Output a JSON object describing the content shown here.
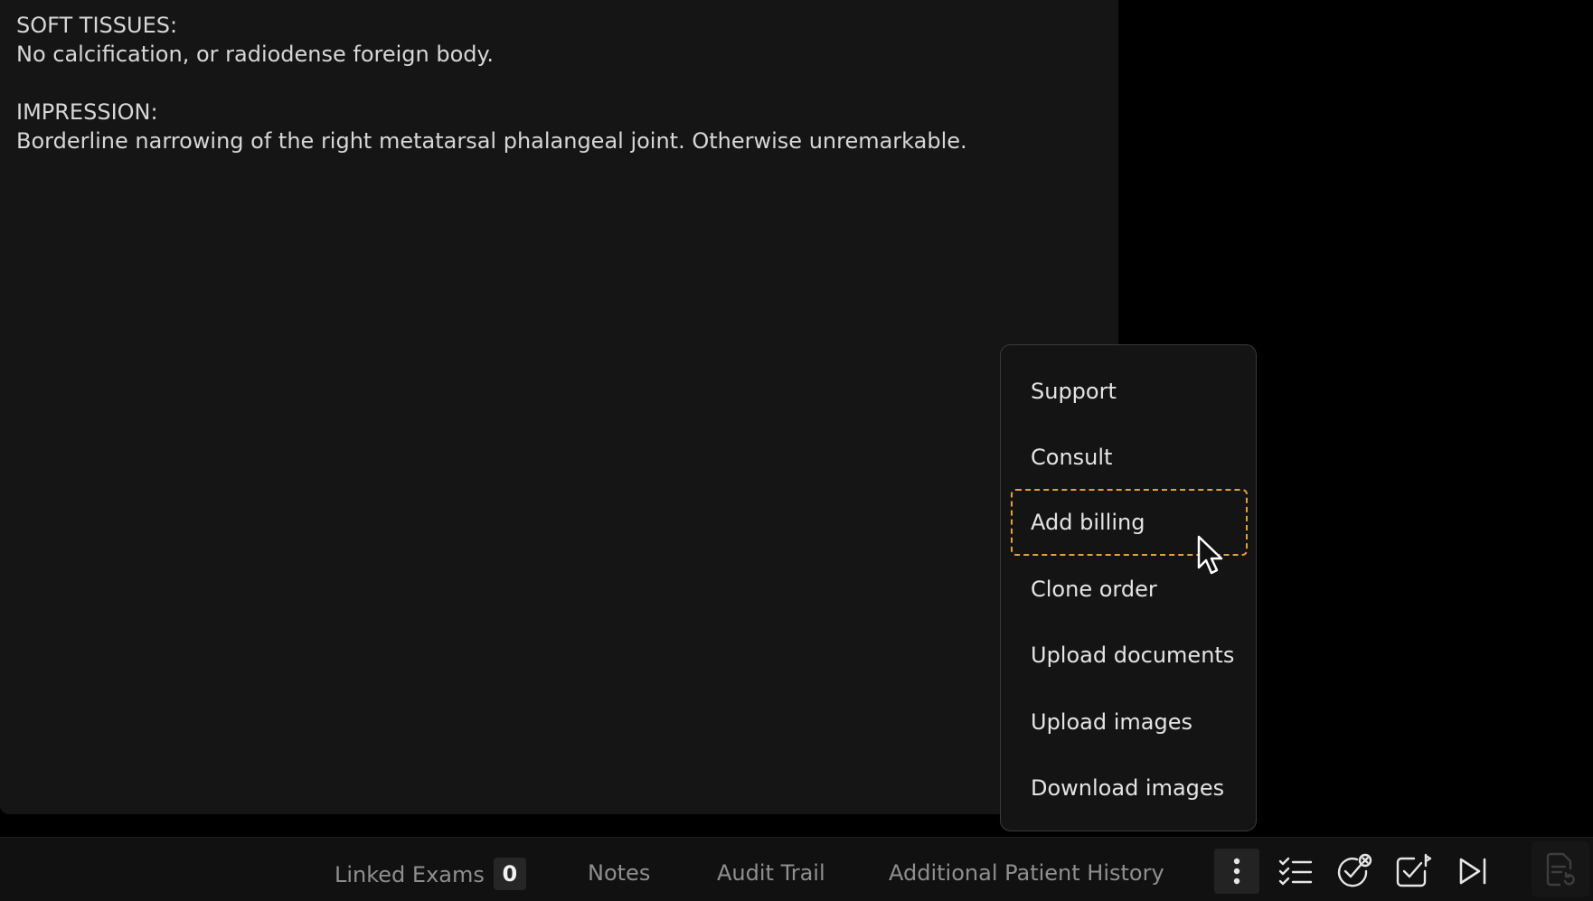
{
  "report": {
    "soft_tissues_heading": "SOFT TISSUES:",
    "soft_tissues_text": "No calcification, or radiodense foreign body.",
    "impression_heading": "IMPRESSION:",
    "impression_text": "Borderline narrowing of the right metatarsal phalangeal joint. Otherwise unremarkable."
  },
  "menu": {
    "items": [
      {
        "label": "Support"
      },
      {
        "label": "Consult"
      },
      {
        "label": "Add billing"
      },
      {
        "label": "Clone order"
      },
      {
        "label": "Upload documents"
      },
      {
        "label": "Upload images"
      },
      {
        "label": "Download images"
      }
    ],
    "focused_item": "Add billing",
    "focus_color": "#e2a13a"
  },
  "bottom_bar": {
    "tabs": [
      {
        "label": "Linked Exams",
        "badge": "0"
      },
      {
        "label": "Notes"
      },
      {
        "label": "Audit Trail"
      },
      {
        "label": "Additional Patient History"
      }
    ],
    "icons": [
      "more-vertical-icon",
      "checklist-icon",
      "check-cancel-icon",
      "check-flag-icon",
      "skip-next-icon",
      "document-refresh-icon"
    ]
  }
}
